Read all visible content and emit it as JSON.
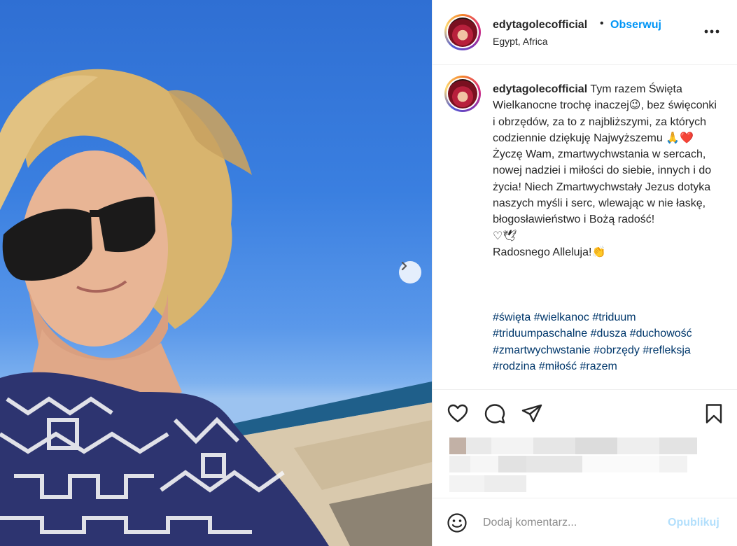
{
  "post": {
    "username": "edytagolecofficial",
    "separator": "•",
    "follow_label": "Obserwuj",
    "location": "Egypt, Africa"
  },
  "caption": {
    "username": "edytagolecofficial",
    "text": " Tym razem Święta Wielkanocne trochę inaczej😉, bez święconki i obrzędów, za to z najbliższymi, za których codziennie dziękuję Najwyższemu 🙏❤️\nŻyczę Wam, zmartwychwstania w sercach, nowej nadziei i miłości do siebie, innych i do życia! Niech Zmartwychwstały Jezus dotyka naszych myśli i serc, wlewając w nie łaskę, błogosławieństwo i Bożą radość!\n♡🕊\nRadosnego Alleluja!👏",
    "hashtags": [
      "#święta",
      "#wielkanoc",
      "#triduum",
      "#triduumpaschalne",
      "#dusza",
      "#duchowość",
      "#zmartwychwstanie",
      "#obrzędy",
      "#refleksja",
      "#rodzina",
      "#miłość",
      "#razem"
    ]
  },
  "actions": {
    "icons": [
      "heart-icon",
      "comment-icon",
      "share-icon",
      "bookmark-icon"
    ]
  },
  "comment_box": {
    "placeholder": "Dodaj komentarz...",
    "publish_label": "Opublikuj"
  },
  "colors": {
    "accent": "#0095f6",
    "hashtag": "#00376b",
    "publish_disabled": "#b2dffc"
  }
}
